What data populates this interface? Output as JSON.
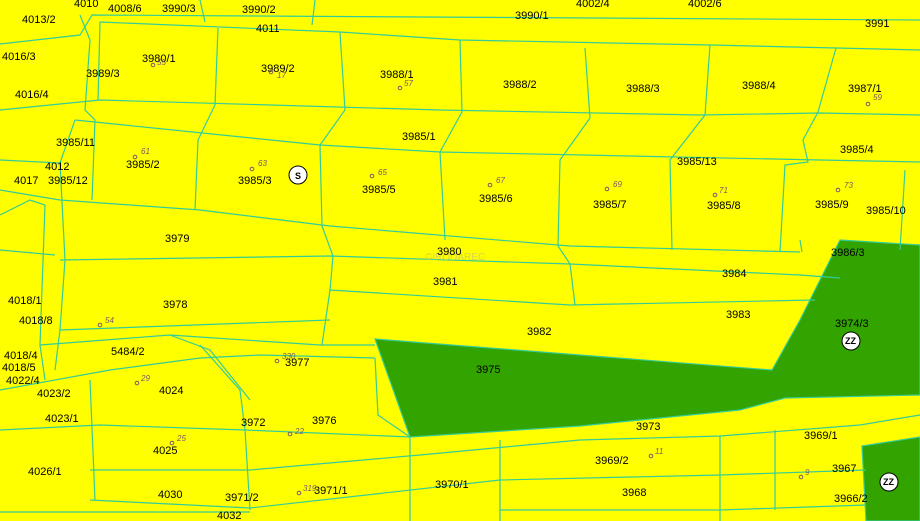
{
  "map": {
    "watermark": "©IRODAREC",
    "parcels": [
      "4010",
      "4008/6",
      "3990/3",
      "3990/2",
      "4002/4",
      "4002/6",
      "4013/2",
      "3990/1",
      "4011",
      "3991",
      "4016/3",
      "3980/1",
      "3989/2",
      "3989/3",
      "3988/1",
      "3988/2",
      "3988/3",
      "3988/4",
      "3987/1",
      "4016/4",
      "3985/1",
      "3985/11",
      "3985/13",
      "3985/4",
      "4012",
      "3985/2",
      "3985/3",
      "4017",
      "3985/12",
      "3985/5",
      "3985/6",
      "3985/7",
      "3985/8",
      "3985/9",
      "3985/10",
      "3979",
      "3980",
      "3986/3",
      "3981",
      "3984",
      "4018/1",
      "3978",
      "4018/8",
      "3983",
      "3982",
      "3974/3",
      "5484/2",
      "3977",
      "4018/4",
      "4018/5",
      "4022/4",
      "3975",
      "4023/2",
      "4024",
      "4023/1",
      "3972",
      "3976",
      "3973",
      "3969/1",
      "4025",
      "4026/1",
      "3969/2",
      "3967",
      "3970/1",
      "4030",
      "3971/2",
      "3971/1",
      "3968",
      "3966/2",
      "4032"
    ],
    "house_numbers": [
      "55",
      "57",
      "61",
      "63",
      "65",
      "67",
      "69",
      "71",
      "73",
      "59",
      "54",
      "29",
      "25",
      "22",
      "11",
      "9",
      "17",
      "330",
      "319"
    ],
    "markers": [
      {
        "label": "S",
        "type": "school"
      },
      {
        "label": "ZZ",
        "type": "zone"
      },
      {
        "label": "ZZ",
        "type": "zone"
      }
    ]
  }
}
